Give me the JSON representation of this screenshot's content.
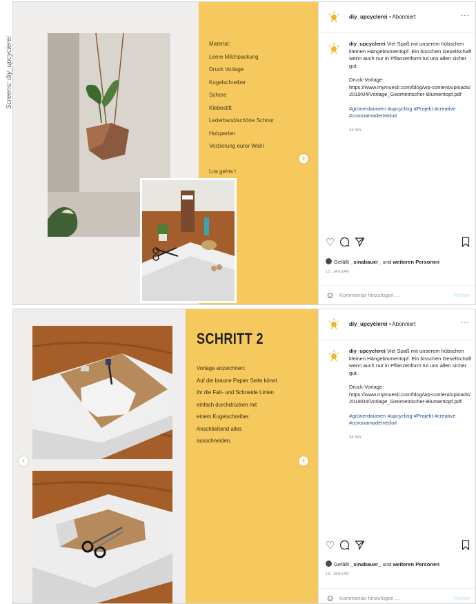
{
  "credit": "Screens: diy_upcyclerei",
  "posts": [
    {
      "username": "diy_upcyclerei",
      "follow_status": "Abonniert",
      "more_icon": "ellipsis-icon",
      "slide": {
        "materials": [
          "Material:",
          "Leere Milchpackung",
          "Druck Vorlage",
          "Kugelschreiber",
          "Schere",
          "Klebestift",
          "Lederband/schöne Schnur",
          "Holzperlen",
          "Verzierung eurer Wahl",
          "",
          "Los gehts !"
        ]
      },
      "caption": {
        "user": "diy_upcyclerei",
        "text": "Viel Spaß mit unserem hübschen kleinen Hängeblumentopf. Ein bisschen Gesellschaft wenn auch nur in Pflanzenform tut uns allen sicher gut.",
        "druck_label": "Druck-Vorlage:",
        "druck_url": "https://www.mymuesli.com/blog/wp-content/uploads/2019/04/Vorlage_Geometrischer-Blumentopf.pdf",
        "hashtags": "#grünerdaumen #upcycling #Projekt #creative #coronamademedoit",
        "timestamp": "34 Wo."
      },
      "likes": {
        "prefix": "Gefällt",
        "user": "_sinabauer_",
        "middle": "und",
        "suffix": "weiteren Personen"
      },
      "date": "13. JANUAR",
      "comment_placeholder": "Kommentar hinzufügen ...",
      "comment_post": "Posten"
    },
    {
      "username": "diy_upcyclerei",
      "follow_status": "Abonniert",
      "more_icon": "ellipsis-icon",
      "slide": {
        "title": "SCHRITT 2",
        "lines": [
          "Vorlage anzeichnen:",
          "Auf die braune Papier Seite könnt",
          "ihr die Falt- und Schneide Linien",
          "einfach durchdrücken mit",
          "einem Kugelschreiber.",
          "Anschließend alles",
          "ausschneiden."
        ]
      },
      "caption": {
        "user": "diy_upcyclerei",
        "text": "Viel Spaß mit unserem hübschen kleinen Hängeblumentopf. Ein bisschen Gesellschaft wenn auch nur in Pflanzenform tut uns allen sicher gut.",
        "druck_label": "Druck-Vorlage:",
        "druck_url": "https://www.mymuesli.com/blog/wp-content/uploads/2019/04/Vorlage_Geometrischer-Blumentopf.pdf",
        "hashtags": "#grünerdaumen #upcycling #Projekt #creative #coronamademedoit",
        "timestamp": "34 Wo."
      },
      "likes": {
        "prefix": "Gefällt",
        "user": "_sinabauer_",
        "middle": "und",
        "suffix": "weiteren Personen"
      },
      "date": "13. JANUAR",
      "comment_placeholder": "Kommentar hinzufügen ...",
      "comment_post": "Posten"
    }
  ],
  "colors": {
    "slide_yellow": "#f5c95d",
    "slide_bg": "#efeeec",
    "hashtag_blue": "#1e4f8f",
    "post_button": "#b2dffc"
  },
  "icons": {
    "like": "heart-icon",
    "comment": "comment-icon",
    "share": "send-icon",
    "save": "bookmark-icon",
    "emoji": "smiley-icon",
    "next": "chevron-right-icon",
    "prev": "chevron-left-icon",
    "logo": "sun-logo-icon"
  }
}
